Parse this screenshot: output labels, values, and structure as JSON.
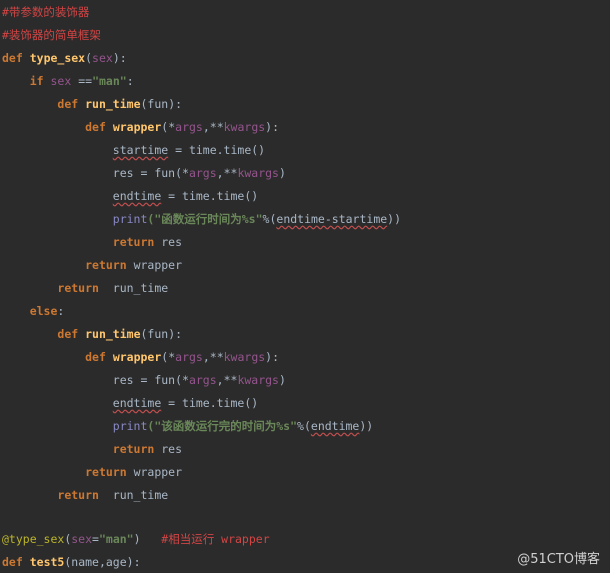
{
  "code": {
    "c1": "#带参数的装饰器",
    "c2": "#装饰器的简单框架",
    "l3_kw": "def",
    "l3_fn": "type_sex",
    "l3_open": "(",
    "l3_param": "sex",
    "l3_close": "):",
    "l4_if": "if",
    "l4_sex": "sex",
    "l4_eq": "==",
    "l4_str": "\"man\"",
    "l4_colon": ":",
    "l5_kw": "def",
    "l5_fn": "run_time",
    "l5_rest": "(fun):",
    "l6_kw": "def",
    "l6_fn": "wrapper",
    "l6_a": "(*",
    "l6_args": "args",
    "l6_b": ",**",
    "l6_kwargs": "kwargs",
    "l6_c": "):",
    "l7_var": "startime",
    "l7_rest": " = time.time()",
    "l8_a": "res = fun(*",
    "l8_args": "args",
    "l8_b": ",**",
    "l8_kwargs": "kwargs",
    "l8_c": ")",
    "l9_var": "endtime",
    "l9_rest": " = time.time()",
    "l10_print": "print",
    "l10_str": "(\"函数运行时间为%s\"",
    "l10_pct": "%(",
    "l10_expr": "endtime-startime",
    "l10_close": "))",
    "l11_kw": "return",
    "l11_rest": " res",
    "l12_kw": "return",
    "l12_rest": " wrapper",
    "l13_kw": "return",
    "l13_rest": "  run_time",
    "l14_kw": "else",
    "l15_kw": "def",
    "l15_fn": "run_time",
    "l15_rest": "(fun):",
    "l16_kw": "def",
    "l16_fn": "wrapper",
    "l16_a": "(*",
    "l16_args": "args",
    "l16_b": ",**",
    "l16_kwargs": "kwargs",
    "l16_c": "):",
    "l17_a": "res = fun(*",
    "l17_args": "args",
    "l17_b": ",**",
    "l17_kwargs": "kwargs",
    "l17_c": ")",
    "l18_var": "endtime",
    "l18_rest": " = time.time()",
    "l19_print": "print",
    "l19_str": "(\"该函数运行完的时间为%s\"",
    "l19_pct": "%(",
    "l19_expr": "endtime",
    "l19_close": "))",
    "l20_kw": "return",
    "l20_rest": " res",
    "l21_kw": "return",
    "l21_rest": " wrapper",
    "l22_kw": "return",
    "l22_rest": "  run_time",
    "l24_deco": "@type_sex",
    "l24_open": "(",
    "l24_param": "sex",
    "l24_eq": "=",
    "l24_str": "\"man\"",
    "l24_close": ")",
    "l24_cmt": "   #相当运行 wrapper",
    "l25_kw": "def",
    "l25_fn": "test5",
    "l25_rest": "(name,age):"
  },
  "watermark": "@51CTO博客"
}
